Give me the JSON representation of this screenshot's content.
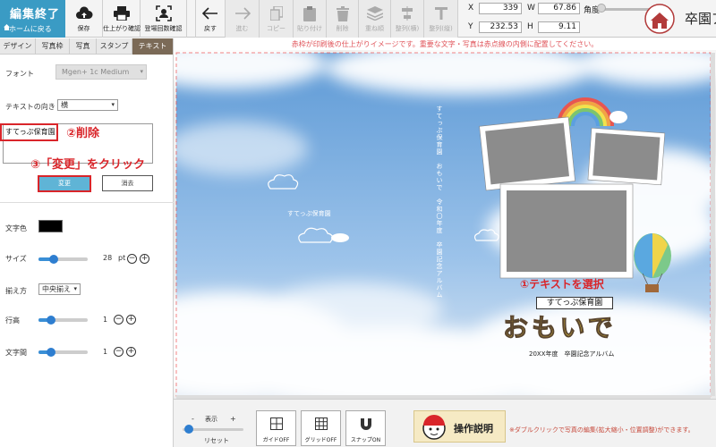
{
  "toolbar": {
    "finish_title": "編集終了",
    "finish_sub": "ホームに戻る",
    "save": "保存",
    "print_confirm": "仕上がり確認",
    "appearance_confirm": "登場回数確認",
    "undo": "戻す",
    "redo": "進む",
    "copy": "コピー",
    "paste": "貼り付け",
    "delete": "削除",
    "layer": "重ね順",
    "align_h": "整列(横)",
    "align_v": "整列(縦)"
  },
  "coords": {
    "x_label": "X",
    "x_value": "339",
    "y_label": "Y",
    "y_value": "232.53",
    "w_label": "W",
    "w_value": "67.86",
    "h_label": "H",
    "h_value": "9.11",
    "angle_label": "角度"
  },
  "logo": {
    "text": "卒園ア"
  },
  "tabs": [
    {
      "label": "デザイン",
      "active": false
    },
    {
      "label": "写真枠",
      "active": false
    },
    {
      "label": "写真",
      "active": false
    },
    {
      "label": "スタンプ",
      "active": false
    },
    {
      "label": "テキスト",
      "active": true
    }
  ],
  "panel": {
    "font_label": "フォント",
    "font_value": "Mgen+ 1c Medium",
    "direction_label": "テキストの向き",
    "direction_value": "横",
    "text_value": "すてっぷ保育園",
    "change_btn": "変更",
    "clear_btn": "消去",
    "color_label": "文字色",
    "text_color": "#000000",
    "size_label": "サイズ",
    "size_value": "28",
    "size_unit": "pt",
    "size_level": 0.3,
    "align_label": "揃え方",
    "align_value": "中央揃え",
    "line_height_label": "行高",
    "line_height_value": "1",
    "line_height_level": 0.25,
    "letter_spacing_label": "文字間",
    "letter_spacing_value": "1",
    "letter_spacing_level": 0.25
  },
  "annotations": {
    "delete": "②削除",
    "click_change": "③「変更」をクリック",
    "select_text": "①テキストを選択"
  },
  "notice": "赤枠が印刷後の仕上がりイメージです。重要な文字・写真は赤点線の内側に配置してください。",
  "canvas": {
    "vertical_title": "すてっぷ保育園　おもいで　令和〇年度　卒園記念アルバム",
    "small_label": "すてっぷ保育園",
    "selected_text": "すてっぷ保育園",
    "main_title": "おもいで",
    "subtitle": "20XX年度　卒園記念アルバム"
  },
  "bottom": {
    "zoom_minus": "-",
    "zoom_label": "表示",
    "zoom_plus": "+",
    "reset": "リセット",
    "guide": "ガイドOFF",
    "grid": "グリッドOFF",
    "snap": "スナップON",
    "help": "操作説明",
    "help_note": "※ダブルクリックで写真の編集(拡大縮小・位置調整)ができます。"
  },
  "colors": {
    "accent": "#3a9bc4",
    "annotation_red": "#d9252a",
    "active_tab": "#7b6a57",
    "slider": "#2e7ed0"
  }
}
